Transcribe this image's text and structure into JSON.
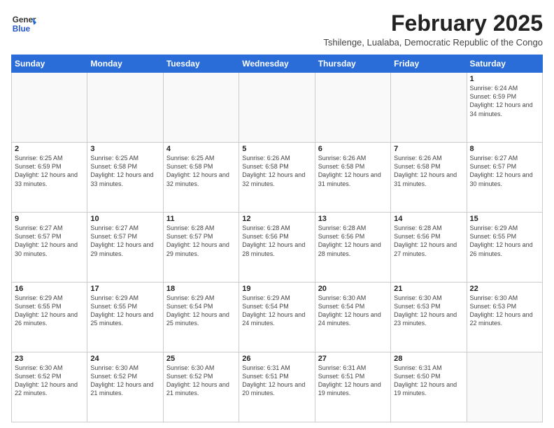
{
  "logo": {
    "general": "General",
    "blue": "Blue"
  },
  "header": {
    "title": "February 2025",
    "subtitle": "Tshilenge, Lualaba, Democratic Republic of the Congo"
  },
  "calendar": {
    "days_of_week": [
      "Sunday",
      "Monday",
      "Tuesday",
      "Wednesday",
      "Thursday",
      "Friday",
      "Saturday"
    ],
    "weeks": [
      [
        {
          "day": "",
          "info": ""
        },
        {
          "day": "",
          "info": ""
        },
        {
          "day": "",
          "info": ""
        },
        {
          "day": "",
          "info": ""
        },
        {
          "day": "",
          "info": ""
        },
        {
          "day": "",
          "info": ""
        },
        {
          "day": "1",
          "info": "Sunrise: 6:24 AM\nSunset: 6:59 PM\nDaylight: 12 hours and 34 minutes."
        }
      ],
      [
        {
          "day": "2",
          "info": "Sunrise: 6:25 AM\nSunset: 6:59 PM\nDaylight: 12 hours and 33 minutes."
        },
        {
          "day": "3",
          "info": "Sunrise: 6:25 AM\nSunset: 6:58 PM\nDaylight: 12 hours and 33 minutes."
        },
        {
          "day": "4",
          "info": "Sunrise: 6:25 AM\nSunset: 6:58 PM\nDaylight: 12 hours and 32 minutes."
        },
        {
          "day": "5",
          "info": "Sunrise: 6:26 AM\nSunset: 6:58 PM\nDaylight: 12 hours and 32 minutes."
        },
        {
          "day": "6",
          "info": "Sunrise: 6:26 AM\nSunset: 6:58 PM\nDaylight: 12 hours and 31 minutes."
        },
        {
          "day": "7",
          "info": "Sunrise: 6:26 AM\nSunset: 6:58 PM\nDaylight: 12 hours and 31 minutes."
        },
        {
          "day": "8",
          "info": "Sunrise: 6:27 AM\nSunset: 6:57 PM\nDaylight: 12 hours and 30 minutes."
        }
      ],
      [
        {
          "day": "9",
          "info": "Sunrise: 6:27 AM\nSunset: 6:57 PM\nDaylight: 12 hours and 30 minutes."
        },
        {
          "day": "10",
          "info": "Sunrise: 6:27 AM\nSunset: 6:57 PM\nDaylight: 12 hours and 29 minutes."
        },
        {
          "day": "11",
          "info": "Sunrise: 6:28 AM\nSunset: 6:57 PM\nDaylight: 12 hours and 29 minutes."
        },
        {
          "day": "12",
          "info": "Sunrise: 6:28 AM\nSunset: 6:56 PM\nDaylight: 12 hours and 28 minutes."
        },
        {
          "day": "13",
          "info": "Sunrise: 6:28 AM\nSunset: 6:56 PM\nDaylight: 12 hours and 28 minutes."
        },
        {
          "day": "14",
          "info": "Sunrise: 6:28 AM\nSunset: 6:56 PM\nDaylight: 12 hours and 27 minutes."
        },
        {
          "day": "15",
          "info": "Sunrise: 6:29 AM\nSunset: 6:55 PM\nDaylight: 12 hours and 26 minutes."
        }
      ],
      [
        {
          "day": "16",
          "info": "Sunrise: 6:29 AM\nSunset: 6:55 PM\nDaylight: 12 hours and 26 minutes."
        },
        {
          "day": "17",
          "info": "Sunrise: 6:29 AM\nSunset: 6:55 PM\nDaylight: 12 hours and 25 minutes."
        },
        {
          "day": "18",
          "info": "Sunrise: 6:29 AM\nSunset: 6:54 PM\nDaylight: 12 hours and 25 minutes."
        },
        {
          "day": "19",
          "info": "Sunrise: 6:29 AM\nSunset: 6:54 PM\nDaylight: 12 hours and 24 minutes."
        },
        {
          "day": "20",
          "info": "Sunrise: 6:30 AM\nSunset: 6:54 PM\nDaylight: 12 hours and 24 minutes."
        },
        {
          "day": "21",
          "info": "Sunrise: 6:30 AM\nSunset: 6:53 PM\nDaylight: 12 hours and 23 minutes."
        },
        {
          "day": "22",
          "info": "Sunrise: 6:30 AM\nSunset: 6:53 PM\nDaylight: 12 hours and 22 minutes."
        }
      ],
      [
        {
          "day": "23",
          "info": "Sunrise: 6:30 AM\nSunset: 6:52 PM\nDaylight: 12 hours and 22 minutes."
        },
        {
          "day": "24",
          "info": "Sunrise: 6:30 AM\nSunset: 6:52 PM\nDaylight: 12 hours and 21 minutes."
        },
        {
          "day": "25",
          "info": "Sunrise: 6:30 AM\nSunset: 6:52 PM\nDaylight: 12 hours and 21 minutes."
        },
        {
          "day": "26",
          "info": "Sunrise: 6:31 AM\nSunset: 6:51 PM\nDaylight: 12 hours and 20 minutes."
        },
        {
          "day": "27",
          "info": "Sunrise: 6:31 AM\nSunset: 6:51 PM\nDaylight: 12 hours and 19 minutes."
        },
        {
          "day": "28",
          "info": "Sunrise: 6:31 AM\nSunset: 6:50 PM\nDaylight: 12 hours and 19 minutes."
        },
        {
          "day": "",
          "info": ""
        }
      ]
    ]
  }
}
